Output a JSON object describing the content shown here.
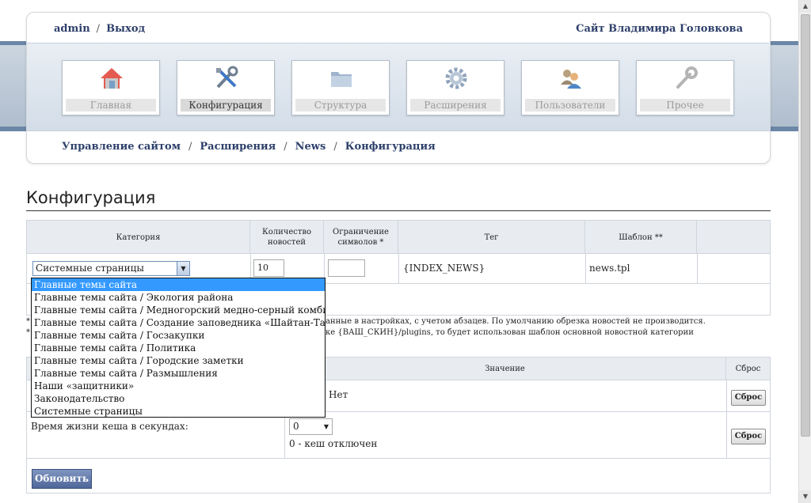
{
  "top": {
    "user": "admin",
    "logout": "Выход",
    "site_title": "Сайт Владимира Головкова"
  },
  "nav": [
    {
      "label": "Главная",
      "icon": "home-icon"
    },
    {
      "label": "Конфигурация",
      "icon": "tools-icon"
    },
    {
      "label": "Структура",
      "icon": "folder-icon"
    },
    {
      "label": "Расширения",
      "icon": "gear-icon"
    },
    {
      "label": "Пользователи",
      "icon": "users-icon"
    },
    {
      "label": "Прочее",
      "icon": "wrench-icon"
    }
  ],
  "breadcrumb": [
    "Управление сайтом",
    "Расширения",
    "News",
    "Конфигурация"
  ],
  "page_title": "Конфигурация",
  "table": {
    "headers": [
      "Категория",
      "Количество новостей",
      "Ограничение символов *",
      "Тег",
      "Шаблон **"
    ],
    "row": {
      "category": "Системные страницы",
      "count": "10",
      "limit": "",
      "tag": "{INDEX_NEWS}",
      "template": "news.tpl"
    }
  },
  "notes": {
    "note1": "анные в настройках, с учетом абзацев. По умолчанию обрезка новостей не производится.",
    "note2": "ке {ВАШ_СКИН}/plugins, то будет использован шаблон основной новостной категории"
  },
  "settings": {
    "value_header": "Значение",
    "reset_header": "Сброс",
    "row1_value": "Нет",
    "row2_label": "Время жизни кеша в секундах:",
    "row2_value": "0",
    "row2_hint": "0 - кеш отключен",
    "reset_label": "Сброс"
  },
  "submit_label": "Обновить",
  "dropdown_options": [
    "Главные темы сайта",
    "Главные темы сайта / Экология района",
    "Главные темы сайта / Медногорский медно-серный комбинат",
    "Главные темы сайта / Создание заповедника «Шайтан-Тау»",
    "Главные темы сайта / Госзакупки",
    "Главные темы сайта / Политика",
    "Главные темы сайта / Городские заметки",
    "Главные темы сайта / Размышления",
    "Наши «защитники»",
    "Законодательство",
    "Системные страницы"
  ],
  "colors": {
    "link": "#2d3f6a",
    "stripe": "#6b86a6",
    "selected_option": "#3399ff",
    "submit": "#4f6699"
  }
}
